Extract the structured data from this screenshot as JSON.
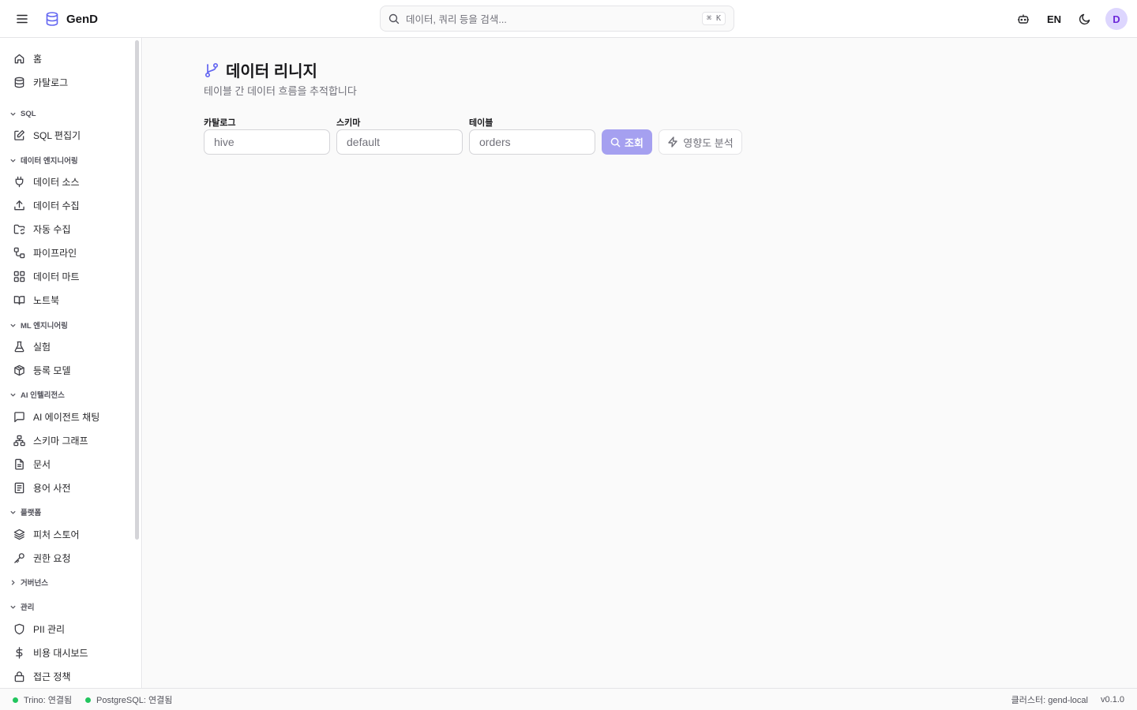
{
  "app": {
    "name": "GenD"
  },
  "header": {
    "search_placeholder": "데이터, 쿼리 등을 검색...",
    "search_shortcut": "⌘ K",
    "lang": "EN",
    "avatar_initial": "D"
  },
  "sidebar": {
    "home": "홈",
    "catalog": "카탈로그",
    "sql_section": "SQL",
    "sql_editor": "SQL 편집기",
    "de_section": "데이터 엔지니어링",
    "data_source": "데이터 소스",
    "data_ingest": "데이터 수집",
    "auto_ingest": "자동 수집",
    "pipeline": "파이프라인",
    "data_mart": "데이터 마트",
    "notebook": "노트북",
    "ml_section": "ML 엔지니어링",
    "experiment": "실험",
    "registered_model": "등록 모델",
    "ai_section": "AI 인텔리전스",
    "ai_chat": "AI 에이전트 채팅",
    "schema_graph": "스키마 그래프",
    "documents": "문서",
    "glossary": "용어 사전",
    "platform_section": "플랫폼",
    "feature_store": "피처 스토어",
    "access_request": "권한 요청",
    "governance_section": "거버넌스",
    "admin_section": "관리",
    "pii": "PII 관리",
    "cost_dashboard": "비용 대시보드",
    "access_policy": "접근 정책"
  },
  "main": {
    "title": "데이터 리니지",
    "subtitle": "테이블 간 데이터 흐름을 추적합니다",
    "catalog_label": "카탈로그",
    "catalog_placeholder": "hive",
    "schema_label": "스키마",
    "schema_placeholder": "default",
    "table_label": "테이블",
    "table_placeholder": "orders",
    "query_button": "조회",
    "impact_button": "영향도 분석"
  },
  "statusbar": {
    "trino": "Trino: 연결됨",
    "postgres": "PostgreSQL: 연결됨",
    "cluster": "클러스터: gend-local",
    "version": "v0.1.0"
  },
  "colors": {
    "accent": "#6366f1",
    "accent_light": "#a5a0f0",
    "status_ok": "#22c55e"
  }
}
